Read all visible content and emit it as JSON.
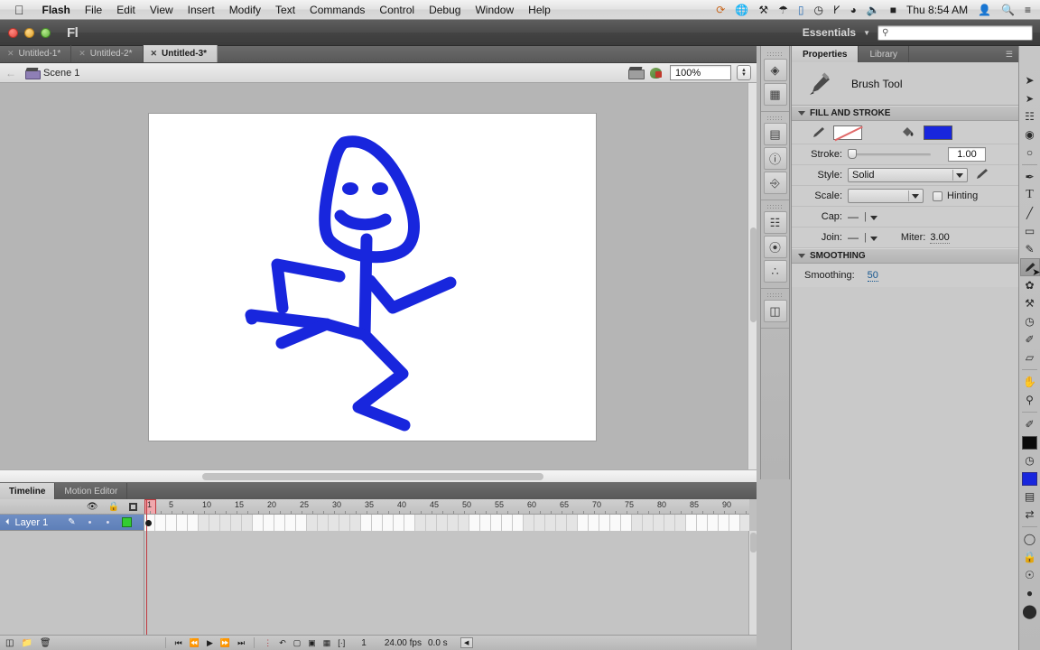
{
  "macos_menubar": {
    "apple_icon": "apple-icon",
    "app_name": "Flash",
    "menus": [
      "File",
      "Edit",
      "View",
      "Insert",
      "Modify",
      "Text",
      "Commands",
      "Control",
      "Debug",
      "Window",
      "Help"
    ],
    "status_icons": [
      "crashplan-icon",
      "globe-icon",
      "plug-icon",
      "airdrop-icon",
      "airplay-icon",
      "timemachine-icon",
      "bluetooth-icon",
      "wifi-icon",
      "volume-icon",
      "battery-icon"
    ],
    "clock": "Thu 8:54 AM",
    "user_icon": "user-icon",
    "spotlight_icon": "search-icon",
    "notification_icon": "notification-center-icon"
  },
  "app_titlebar": {
    "logo": "Fl",
    "workspace": "Essentials",
    "workspace_caret": "chevron-down-icon",
    "search_placeholder": "",
    "search_value": "",
    "search_icon": "search-icon"
  },
  "document_tabs": [
    {
      "label": "Untitled-1*",
      "active": false
    },
    {
      "label": "Untitled-2*",
      "active": false
    },
    {
      "label": "Untitled-3*",
      "active": true
    }
  ],
  "edit_bar": {
    "back_icon": "back-arrow-icon",
    "scene_icon": "scene-icon",
    "scene_label": "Scene 1",
    "edit_scene_icon": "edit-scene-icon",
    "edit_symbols_icon": "edit-symbols-icon",
    "zoom_value": "100%",
    "zoom_stepper_icon": "stepper-icon"
  },
  "stage": {
    "background_color": "#b5b5b5",
    "canvas_color": "#ffffff",
    "drawing_name": "stick-figure-drawing",
    "drawing_color": "#1826dd"
  },
  "rail": {
    "groups": [
      {
        "items": [
          {
            "name": "color-palette-icon",
            "glyph": "◕"
          },
          {
            "name": "swatches-icon",
            "glyph": "▦"
          }
        ]
      },
      {
        "items": [
          {
            "name": "align-icon",
            "glyph": "☰"
          },
          {
            "name": "info-icon",
            "glyph": "ℹ"
          },
          {
            "name": "transform-icon",
            "glyph": "⛶"
          }
        ]
      },
      {
        "items": [
          {
            "name": "code-snippets-icon",
            "glyph": "≡"
          },
          {
            "name": "components-icon",
            "glyph": "●"
          },
          {
            "name": "motion-presets-icon",
            "glyph": "∴"
          }
        ]
      },
      {
        "items": [
          {
            "name": "project-icon",
            "glyph": "▤"
          }
        ]
      }
    ]
  },
  "properties_panel": {
    "tabs": [
      {
        "label": "Properties",
        "active": true
      },
      {
        "label": "Library",
        "active": false
      }
    ],
    "panel_menu_icon": "panel-menu-icon",
    "tool": {
      "icon": "brush-tool-icon",
      "name": "Brush Tool"
    },
    "fill_and_stroke": {
      "header": "FILL AND STROKE",
      "disclosure_icon": "triangle-down-icon",
      "stroke_color_icon": "pencil-icon",
      "stroke_swatch": "none",
      "fill_color_icon": "paint-bucket-icon",
      "fill_swatch_color": "#1826dd",
      "stroke_label": "Stroke:",
      "stroke_value": "1.00",
      "style_label": "Style:",
      "style_value": "Solid",
      "style_edit_icon": "pencil-edit-icon",
      "scale_label": "Scale:",
      "scale_value": "",
      "hinting_label": "Hinting",
      "hinting_checked": false,
      "cap_label": "Cap:",
      "cap_value": "—",
      "join_label": "Join:",
      "join_value": "—",
      "miter_label": "Miter:",
      "miter_value": "3.00"
    },
    "smoothing": {
      "header": "SMOOTHING",
      "disclosure_icon": "triangle-down-icon",
      "label": "Smoothing:",
      "value": "50"
    }
  },
  "tools_palette": {
    "groups": [
      [
        {
          "name": "selection-tool-icon",
          "glyph": "➤",
          "selected": false
        },
        {
          "name": "subselection-tool-icon",
          "glyph": "➤",
          "selected": false
        },
        {
          "name": "free-transform-tool-icon",
          "glyph": "⬚",
          "selected": false
        },
        {
          "name": "3d-rotation-tool-icon",
          "glyph": "◕",
          "selected": false
        },
        {
          "name": "lasso-tool-icon",
          "glyph": "○",
          "selected": false
        }
      ],
      [
        {
          "name": "pen-tool-icon",
          "glyph": "✒",
          "selected": false
        },
        {
          "name": "text-tool-icon",
          "glyph": "T",
          "selected": false
        },
        {
          "name": "line-tool-icon",
          "glyph": "╱",
          "selected": false
        },
        {
          "name": "rectangle-tool-icon",
          "glyph": "▭",
          "selected": false
        },
        {
          "name": "pencil-tool-icon",
          "glyph": "✎",
          "selected": false
        },
        {
          "name": "brush-tool-icon",
          "glyph": "ᖇ",
          "selected": true
        },
        {
          "name": "deco-tool-icon",
          "glyph": "✿",
          "selected": false
        },
        {
          "name": "bone-tool-icon",
          "glyph": "⚒",
          "selected": false
        },
        {
          "name": "paint-bucket-tool-icon",
          "glyph": "◗",
          "selected": false
        },
        {
          "name": "eyedropper-tool-icon",
          "glyph": "✐",
          "selected": false
        },
        {
          "name": "eraser-tool-icon",
          "glyph": "▱",
          "selected": false
        }
      ],
      [
        {
          "name": "hand-tool-icon",
          "glyph": "✋",
          "selected": false
        },
        {
          "name": "zoom-tool-icon",
          "glyph": "⚲",
          "selected": false
        }
      ],
      [
        {
          "name": "stroke-color-icon",
          "glyph": "✐",
          "selected": false
        },
        {
          "name": "stroke-color-swatch",
          "glyph": "",
          "selected": false,
          "color": "#000000"
        },
        {
          "name": "fill-color-icon",
          "glyph": "◗",
          "selected": false
        },
        {
          "name": "fill-color-swatch",
          "glyph": "",
          "selected": false,
          "color": "#1826dd"
        },
        {
          "name": "black-and-white-icon",
          "glyph": "◰",
          "selected": false
        },
        {
          "name": "swap-colors-icon",
          "glyph": "⇄",
          "selected": false
        }
      ],
      [
        {
          "name": "object-drawing-icon",
          "glyph": "○",
          "selected": false
        },
        {
          "name": "lock-fill-icon",
          "glyph": "⚿",
          "selected": false
        },
        {
          "name": "smooth-option-icon",
          "glyph": "◎",
          "selected": false
        },
        {
          "name": "brush-size-icon",
          "glyph": "●",
          "selected": false
        },
        {
          "name": "brush-shape-icon",
          "glyph": "⬤",
          "selected": false
        }
      ]
    ]
  },
  "timeline": {
    "tabs": [
      {
        "label": "Timeline",
        "active": true
      },
      {
        "label": "Motion Editor",
        "active": false
      }
    ],
    "header_icons": [
      "eye-icon",
      "lock-icon",
      "outline-icon"
    ],
    "layers": [
      {
        "name": "Layer 1",
        "type_icon": "layer-icon",
        "pencil_icon": "edit-pencil-icon",
        "visible_dot": "•",
        "lock_dot": "•",
        "outline_color": "#33cc33"
      }
    ],
    "ruler_labels": [
      1,
      5,
      10,
      15,
      20,
      25,
      30,
      35,
      40,
      45,
      50,
      55,
      60,
      65,
      70,
      75,
      80,
      85,
      90
    ],
    "current_frame_marker": 1,
    "status": {
      "new_layer_icon": "new-layer-icon",
      "new_folder_icon": "new-folder-icon",
      "delete_icon": "trash-icon",
      "playback_icons": [
        "first-frame-icon",
        "step-back-icon",
        "play-icon",
        "step-forward-icon",
        "last-frame-icon"
      ],
      "onion_icons": [
        "center-frame-icon",
        "loop-icon",
        "onion-skin-icon",
        "onion-outline-icon",
        "edit-multiple-frames-icon",
        "modify-markers-icon"
      ],
      "current_frame": "1",
      "frame_rate": "24.00 fps",
      "elapsed": "0.0 s",
      "resize_icon": "resize-icon"
    }
  }
}
